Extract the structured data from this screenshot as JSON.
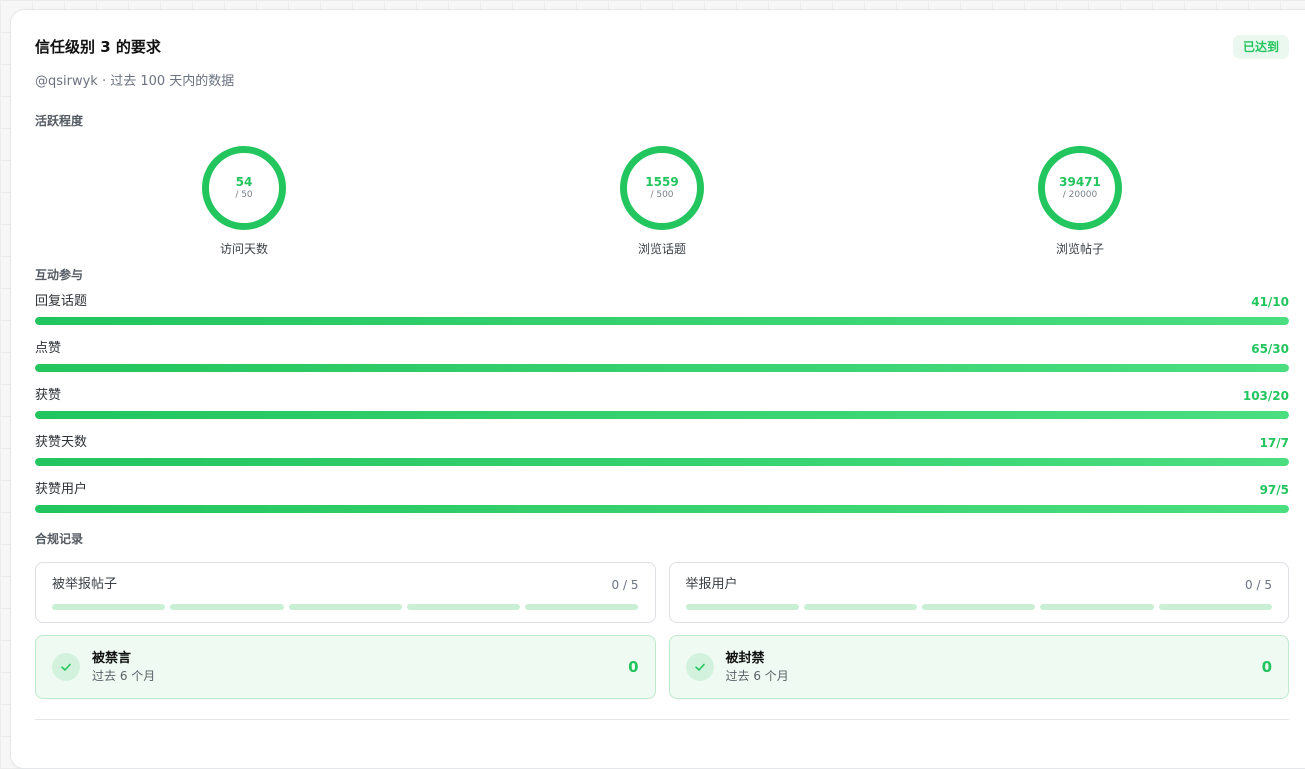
{
  "header": {
    "title": "信任级别 3 的要求",
    "badge": "已达到",
    "subtitle": "@qsirwyk · 过去 100 天内的数据"
  },
  "activity": {
    "section_title": "活跃程度",
    "items": [
      {
        "value": "54",
        "target": "/ 50",
        "label": "访问天数",
        "progress": 1.0
      },
      {
        "value": "1559",
        "target": "/ 500",
        "label": "浏览话题",
        "progress": 1.0
      },
      {
        "value": "39471",
        "target": "/ 20000",
        "label": "浏览帖子",
        "progress": 1.0
      }
    ]
  },
  "interaction": {
    "section_title": "互动参与",
    "items": [
      {
        "label": "回复话题",
        "value": "41/10",
        "progress": 1.0
      },
      {
        "label": "点赞",
        "value": "65/30",
        "progress": 1.0
      },
      {
        "label": "获赞",
        "value": "103/20",
        "progress": 1.0
      },
      {
        "label": "获赞天数",
        "value": "17/7",
        "progress": 1.0
      },
      {
        "label": "获赞用户",
        "value": "97/5",
        "progress": 1.0
      }
    ]
  },
  "compliance": {
    "section_title": "合规记录",
    "reports": [
      {
        "label": "被举报帖子",
        "value": "0 / 5"
      },
      {
        "label": "举报用户",
        "value": "0 / 5"
      }
    ],
    "penalties": [
      {
        "title": "被禁言",
        "sub": "过去 6 个月",
        "count": "0"
      },
      {
        "title": "被封禁",
        "sub": "过去 6 个月",
        "count": "0"
      }
    ]
  },
  "colors": {
    "accent": "#22c55e",
    "accent_light": "#4ade80",
    "success_bg": "#effbf2",
    "segment_empty": "#c9efd5"
  }
}
